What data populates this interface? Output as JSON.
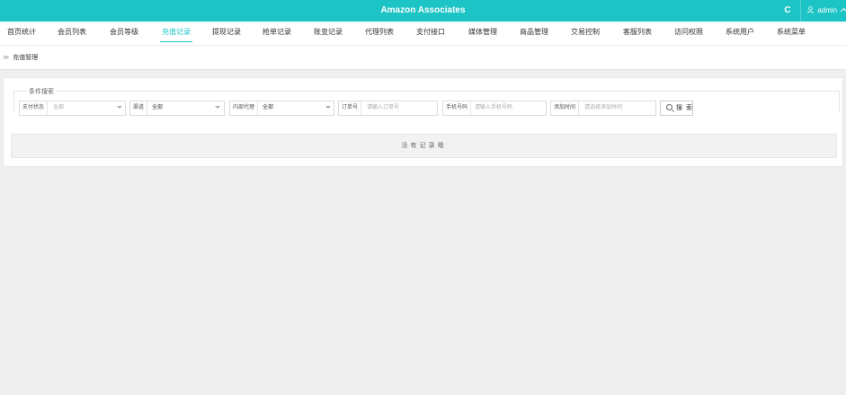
{
  "header": {
    "title": "Amazon Associates",
    "refresh_glyph": "C",
    "refresh_icon": "refresh-icon",
    "user_icon": "user-icon",
    "username": "admin",
    "user_caret": "^",
    "bg_color": "#1cc4c5"
  },
  "nav": {
    "tabs": [
      {
        "label": "首页统计"
      },
      {
        "label": "会员列表"
      },
      {
        "label": "会员等级"
      },
      {
        "label": "充值记录"
      },
      {
        "label": "提现记录"
      },
      {
        "label": "抢单记录"
      },
      {
        "label": "账变记录"
      },
      {
        "label": "代理列表"
      },
      {
        "label": "支付接口"
      },
      {
        "label": "媒体管理"
      },
      {
        "label": "商品管理"
      },
      {
        "label": "交易控制"
      },
      {
        "label": "客服列表"
      },
      {
        "label": "访问权限"
      },
      {
        "label": "系统用户"
      },
      {
        "label": "系统菜单"
      }
    ],
    "active_index": 3,
    "active_color": "#1cc4c5"
  },
  "breadcrumb": {
    "separator": "≫",
    "current": "充值管理"
  },
  "search": {
    "legend": "条件搜索",
    "fields": [
      {
        "label": "支付状态",
        "value": "全部",
        "placeholder": true,
        "dropdown": true
      },
      {
        "label": "渠道",
        "value": "全部",
        "placeholder": false,
        "dropdown": true
      },
      {
        "label": "内部代理",
        "value": "全部",
        "placeholder": false,
        "dropdown": true
      },
      {
        "label": "订单号",
        "value": "请输入订单号",
        "placeholder": true,
        "dropdown": false
      },
      {
        "label": "手机号码",
        "value": "请输入手机号码",
        "placeholder": true,
        "dropdown": false
      },
      {
        "label": "添加时间",
        "value": "请选择添加时间",
        "placeholder": true,
        "dropdown": false
      }
    ],
    "button_label": "搜 索",
    "button_icon": "search-icon"
  },
  "table": {
    "empty_message": "没有记录哦"
  }
}
